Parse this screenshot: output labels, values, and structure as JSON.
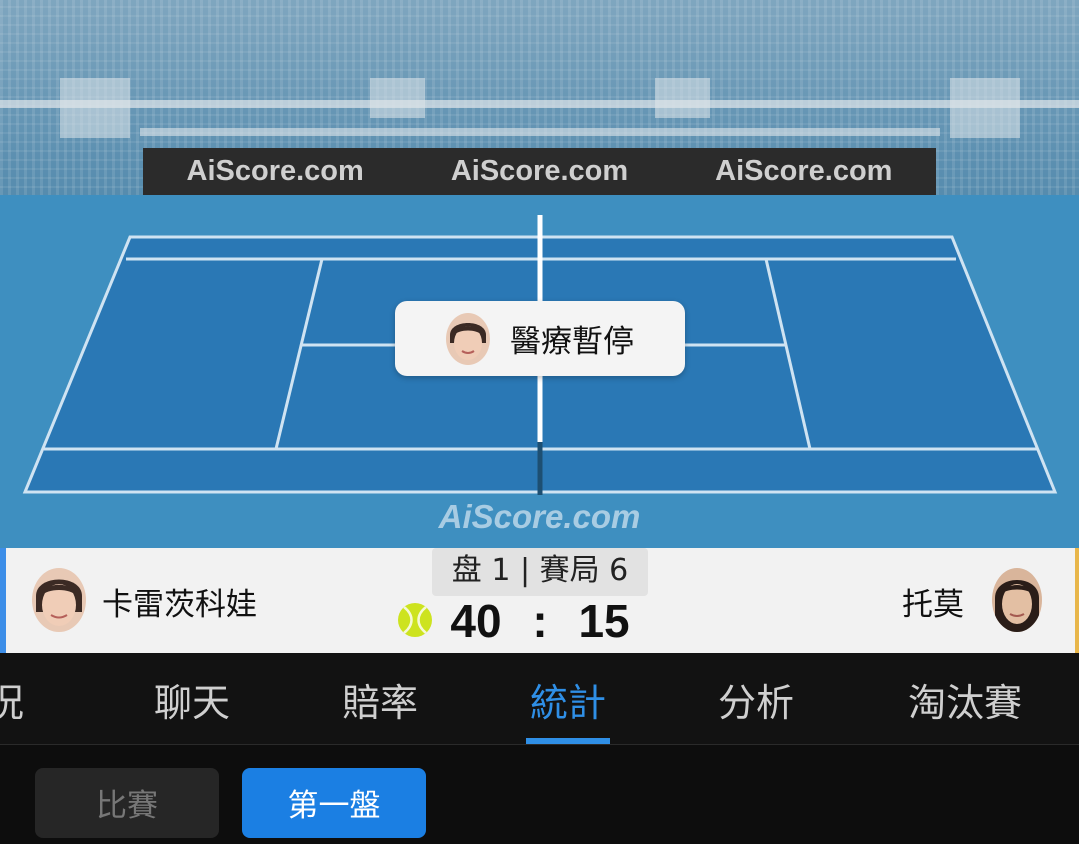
{
  "court": {
    "ad_boards": [
      "AiScore.com",
      "AiScore.com",
      "AiScore.com"
    ],
    "watermark": "AiScore.com",
    "status_text": "醫療暫停"
  },
  "match": {
    "set_game_label": "盘 1 | 賽局 6",
    "home": {
      "name": "卡雷茨科娃",
      "score": "40"
    },
    "away": {
      "name": "托莫",
      "score": "15"
    },
    "separator": ":"
  },
  "tabs": [
    {
      "label": "況"
    },
    {
      "label": "聊天"
    },
    {
      "label": "賠率"
    },
    {
      "label": "統計",
      "active": true
    },
    {
      "label": "分析"
    },
    {
      "label": "淘汰賽"
    }
  ],
  "segments": [
    {
      "label": "比賽"
    },
    {
      "label": "第一盤",
      "active": true
    }
  ],
  "colors": {
    "accent": "#2f8fe6",
    "court": "#2a78b5",
    "court_surround": "#3e8fc0",
    "home_edge": "#3d8ee8",
    "away_edge": "#e8b64a",
    "ball": "#cde31f"
  }
}
